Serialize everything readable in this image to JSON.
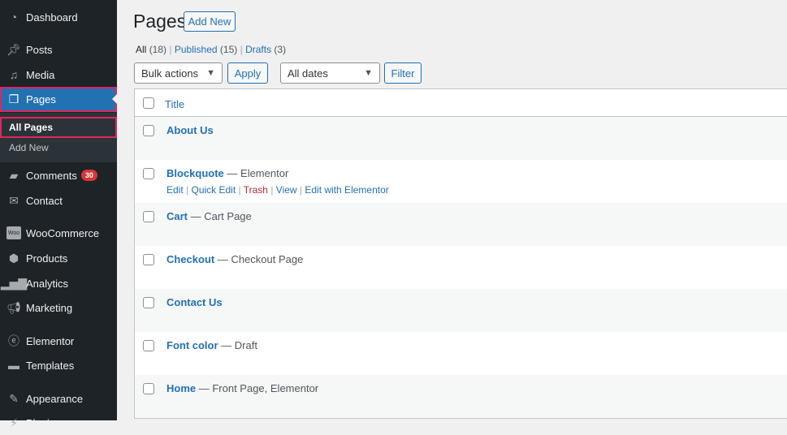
{
  "sidebar": {
    "items": [
      {
        "label": "Dashboard",
        "icon": "dashboard-icon"
      },
      {
        "label": "Posts",
        "icon": "pin-icon"
      },
      {
        "label": "Media",
        "icon": "media-icon"
      },
      {
        "label": "Pages",
        "icon": "pages-icon"
      },
      {
        "label": "Comments",
        "icon": "comment-icon",
        "badge": "30"
      },
      {
        "label": "Contact",
        "icon": "mail-icon"
      },
      {
        "label": "WooCommerce",
        "icon": "woo-icon"
      },
      {
        "label": "Products",
        "icon": "box-icon"
      },
      {
        "label": "Analytics",
        "icon": "bar-chart-icon"
      },
      {
        "label": "Marketing",
        "icon": "megaphone-icon"
      },
      {
        "label": "Elementor",
        "icon": "elementor-icon"
      },
      {
        "label": "Templates",
        "icon": "folder-icon"
      },
      {
        "label": "Appearance",
        "icon": "brush-icon"
      },
      {
        "label": "Plugins",
        "icon": "plug-icon"
      }
    ],
    "submenu": [
      {
        "label": "All Pages"
      },
      {
        "label": "Add New"
      }
    ],
    "accent": "#2271b1",
    "highlight": "#e0245e"
  },
  "header": {
    "title": "Pages",
    "add_new": "Add New"
  },
  "filters": {
    "all": "All",
    "all_count": "(18)",
    "published": "Published",
    "published_count": "(15)",
    "drafts": "Drafts",
    "drafts_count": "(3)",
    "sep": "|",
    "bulk": "Bulk actions",
    "apply": "Apply",
    "dates": "All dates",
    "filter": "Filter"
  },
  "table": {
    "col_title": "Title",
    "rows": [
      {
        "title": "About Us",
        "state": ""
      },
      {
        "title": "Blockquote",
        "state": " — Elementor",
        "actions": {
          "edit": "Edit",
          "quick": "Quick Edit",
          "trash": "Trash",
          "view": "View",
          "elementor": "Edit with Elementor"
        }
      },
      {
        "title": "Cart",
        "state": " — Cart Page"
      },
      {
        "title": "Checkout",
        "state": " — Checkout Page"
      },
      {
        "title": "Contact Us",
        "state": ""
      },
      {
        "title": "Font color",
        "state": " — Draft"
      },
      {
        "title": "Home",
        "state": " — Front Page, Elementor"
      }
    ]
  }
}
